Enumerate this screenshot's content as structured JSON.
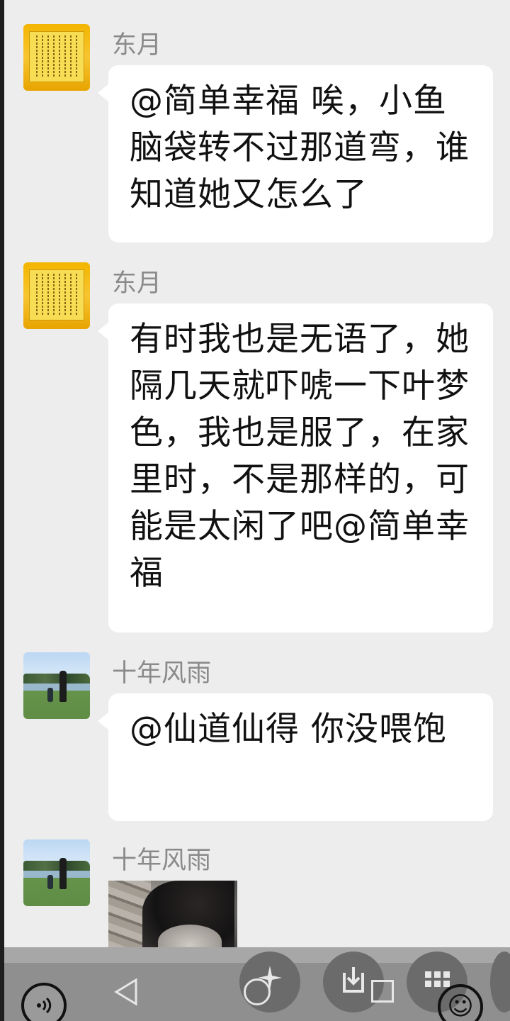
{
  "messages": [
    {
      "sender": "东月",
      "avatar": "scroll-calligraphy",
      "text": "@简单幸福  唉，小鱼脑袋转不过那道弯，谁知道她又怎么了"
    },
    {
      "sender": "东月",
      "avatar": "scroll-calligraphy",
      "text": "有时我也是无语了，她隔几天就吓唬一下叶梦色，我也是服了，在家里时，不是那样的，可能是太闲了吧@简单幸福"
    },
    {
      "sender": "十年风雨",
      "avatar": "park-photo",
      "text": "@仙道仙得  你没喂饱"
    },
    {
      "sender": "十年风雨",
      "avatar": "park-photo",
      "image": "photo-person"
    }
  ],
  "navbar": {
    "voice_icon": "voice-input-icon",
    "back_icon": "◁",
    "emoji_icon": "☺"
  },
  "colors": {
    "background": "#ededed",
    "bubble": "#ffffff",
    "name_text": "#8a8a8a",
    "navbar": "#8f8f8f"
  }
}
